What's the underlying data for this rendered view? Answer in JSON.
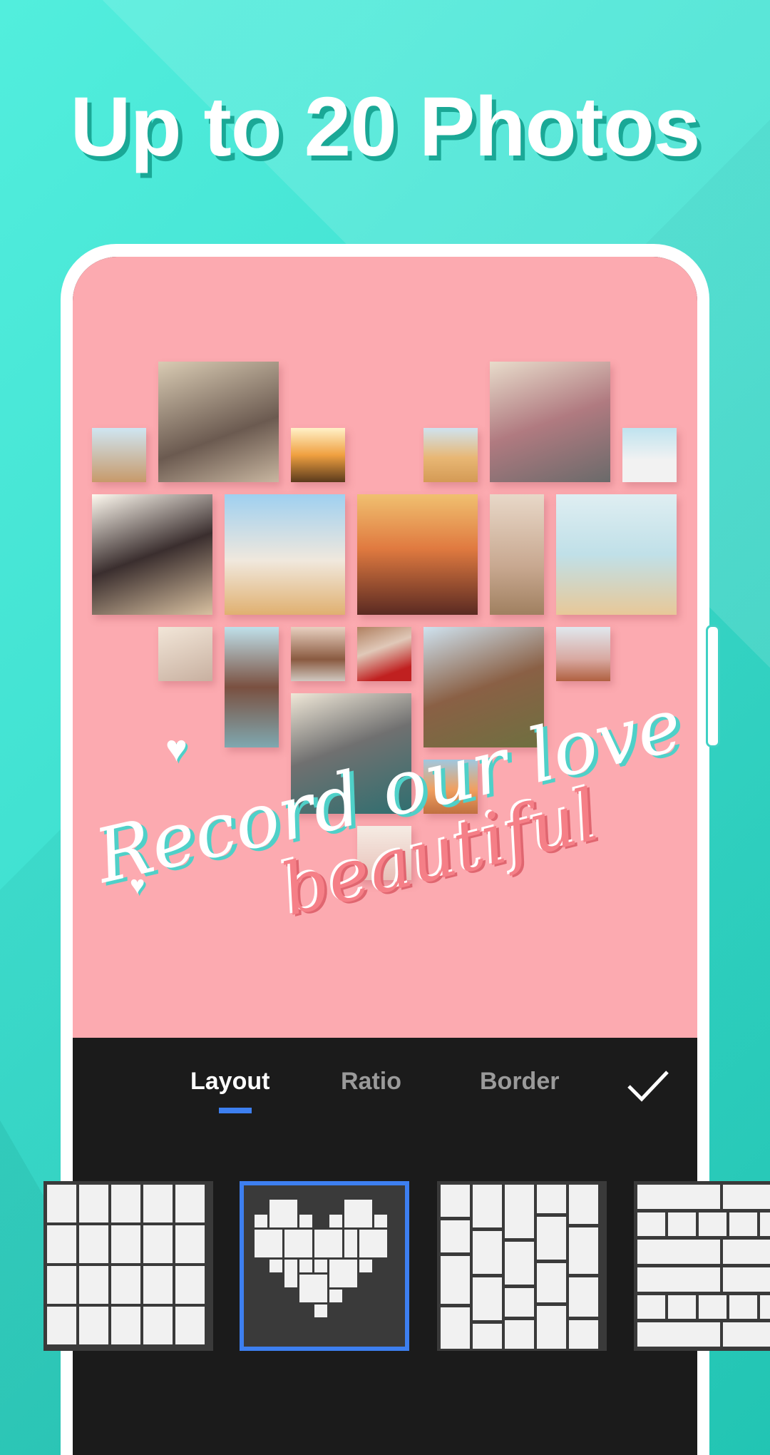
{
  "headline": "Up to 20 Photos",
  "canvas": {
    "background_color": "#fcaab0",
    "overlay_text_1": "Record our love",
    "overlay_text_2": "beautiful",
    "photo_count": 20
  },
  "toolbar": {
    "tabs": [
      {
        "label": "Layout",
        "active": true
      },
      {
        "label": "Ratio",
        "active": false
      },
      {
        "label": "Border",
        "active": false
      }
    ],
    "confirm_icon": "checkmark-icon",
    "accent_color": "#3d7ff0"
  },
  "layouts": [
    {
      "name": "wavy-grid",
      "selected": false
    },
    {
      "name": "heart",
      "selected": true
    },
    {
      "name": "staggered-columns",
      "selected": false
    },
    {
      "name": "brick-rows",
      "selected": false
    }
  ]
}
